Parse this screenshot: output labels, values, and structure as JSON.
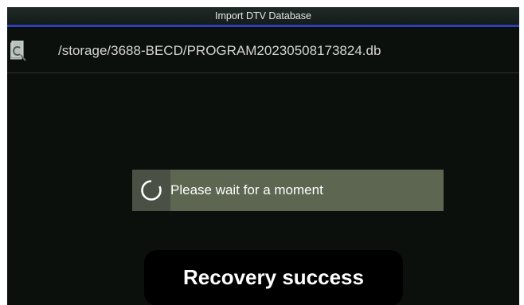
{
  "window": {
    "title": "Import DTV Database",
    "accent_color": "#2f3fb8"
  },
  "file_list": {
    "items": [
      {
        "icon": "database-file-icon",
        "path": "/storage/3688-BECD/PROGRAM20230508173824.db"
      }
    ]
  },
  "progress_dialog": {
    "icon": "loading-spinner-icon",
    "message": "Please wait for a moment",
    "background_color": "#5d6650"
  },
  "toast": {
    "message": "Recovery success"
  }
}
